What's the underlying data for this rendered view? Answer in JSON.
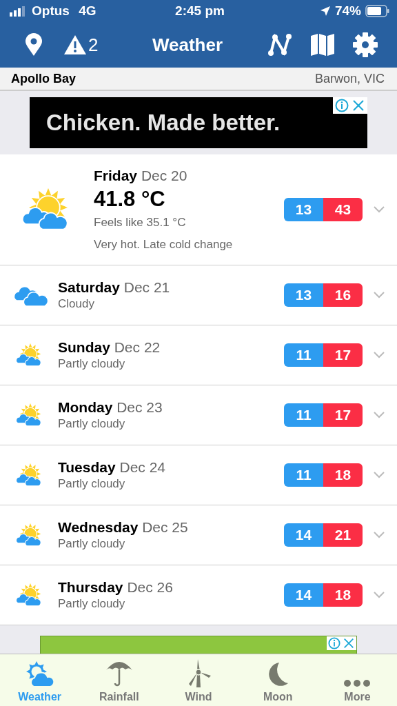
{
  "status_bar": {
    "carrier": "Optus",
    "network": "4G",
    "time": "2:45 pm",
    "battery": "74%"
  },
  "header": {
    "title": "Weather",
    "alert_count": "2"
  },
  "location": {
    "name": "Apollo Bay",
    "region": "Barwon, VIC"
  },
  "ad_banner": {
    "text": "Chicken. Made better."
  },
  "today": {
    "day": "Friday",
    "date": "Dec 20",
    "temperature": "41.8 °C",
    "feels_like": "Feels like 35.1 °C",
    "summary": "Very hot. Late cold change",
    "min": "13",
    "max": "43"
  },
  "forecast": [
    {
      "day": "Saturday",
      "date": "Dec 21",
      "summary": "Cloudy",
      "kind": "cloudy",
      "min": "13",
      "max": "16"
    },
    {
      "day": "Sunday",
      "date": "Dec 22",
      "summary": "Partly cloudy",
      "kind": "partly-cloudy",
      "min": "11",
      "max": "17"
    },
    {
      "day": "Monday",
      "date": "Dec 23",
      "summary": "Partly cloudy",
      "kind": "partly-cloudy",
      "min": "11",
      "max": "17"
    },
    {
      "day": "Tuesday",
      "date": "Dec 24",
      "summary": "Partly cloudy",
      "kind": "partly-cloudy",
      "min": "11",
      "max": "18"
    },
    {
      "day": "Wednesday",
      "date": "Dec 25",
      "summary": "Partly cloudy",
      "kind": "partly-cloudy",
      "min": "14",
      "max": "21"
    },
    {
      "day": "Thursday",
      "date": "Dec 26",
      "summary": "Partly cloudy",
      "kind": "partly-cloudy",
      "min": "14",
      "max": "18"
    }
  ],
  "tab_bar": [
    {
      "label": "Weather",
      "selected": true
    },
    {
      "label": "Rainfall",
      "selected": false
    },
    {
      "label": "Wind",
      "selected": false
    },
    {
      "label": "Moon",
      "selected": false
    },
    {
      "label": "More",
      "selected": false
    }
  ]
}
